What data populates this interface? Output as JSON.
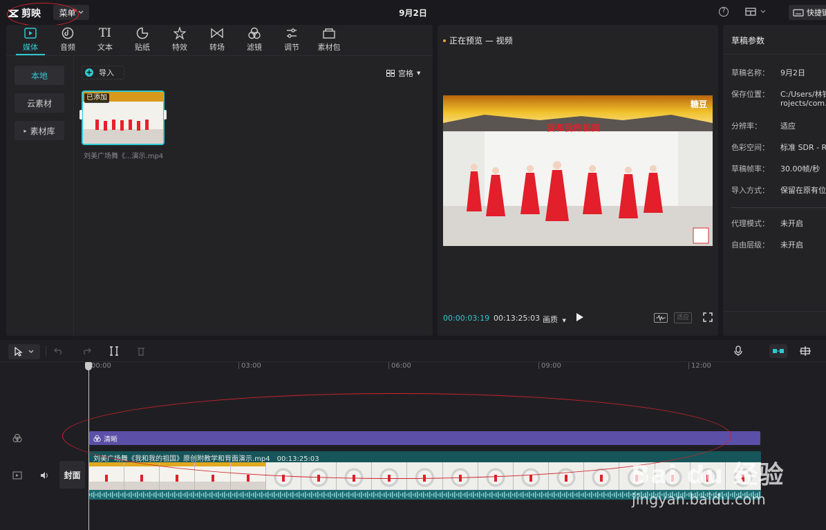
{
  "app": {
    "name": "剪映",
    "menu_label": "菜单",
    "doc_title": "9月2日",
    "shortcut_label": "快捷键"
  },
  "tools": [
    {
      "label": "媒体",
      "icon": "media-icon"
    },
    {
      "label": "音频",
      "icon": "audio-icon"
    },
    {
      "label": "文本",
      "icon": "text-icon"
    },
    {
      "label": "贴纸",
      "icon": "sticker-icon"
    },
    {
      "label": "特效",
      "icon": "effects-icon"
    },
    {
      "label": "转场",
      "icon": "transition-icon"
    },
    {
      "label": "滤镜",
      "icon": "filter-icon"
    },
    {
      "label": "调节",
      "icon": "adjust-icon"
    },
    {
      "label": "素材包",
      "icon": "package-icon"
    }
  ],
  "media": {
    "side": [
      "本地",
      "云素材",
      "素材库"
    ],
    "import_label": "导入",
    "view_label": "宫格",
    "clip": {
      "badge": "已添加",
      "name": "刘美广场舞《...演示.mp4"
    }
  },
  "preview": {
    "title": "正在预览 — 视频",
    "current_time": "00:00:03:19",
    "total_time": "00:13:25:03",
    "quality_label": "画质",
    "fit_label": "适应",
    "video_logo": "糖豆",
    "video_caption": "我和我的祖国"
  },
  "draft": {
    "title": "草稿参数",
    "params": [
      {
        "label": "草稿名称：",
        "value": "9月2日"
      },
      {
        "label": "保存位置：",
        "value": "C:/Users/林钓",
        "value2": "rojects/com."
      },
      {
        "label": "分辨率：",
        "value": "适应"
      },
      {
        "label": "色彩空间：",
        "value": "标准 SDR - Re"
      },
      {
        "label": "草稿帧率：",
        "value": "30.00帧/秒"
      },
      {
        "label": "导入方式：",
        "value": "保留在原有位"
      },
      {
        "label": "代理模式：",
        "value": "未开启"
      },
      {
        "label": "自由层级：",
        "value": "未开启"
      }
    ]
  },
  "timeline": {
    "ticks": [
      "00:00",
      "03:00",
      "06:00",
      "09:00",
      "12:00"
    ],
    "filter_label": "清晰",
    "video_label": "刘美广场舞《我和我的祖国》原创附教学和背面演示.mp4",
    "video_duration": "00:13:25:03",
    "cover_label": "封面"
  },
  "watermark": {
    "main": "Bai du 经验",
    "url": "jingyan.baidu.com"
  },
  "colors": {
    "accent": "#2fc9d1",
    "filter_track": "#5b4fa8",
    "video_track": "#16555a"
  }
}
